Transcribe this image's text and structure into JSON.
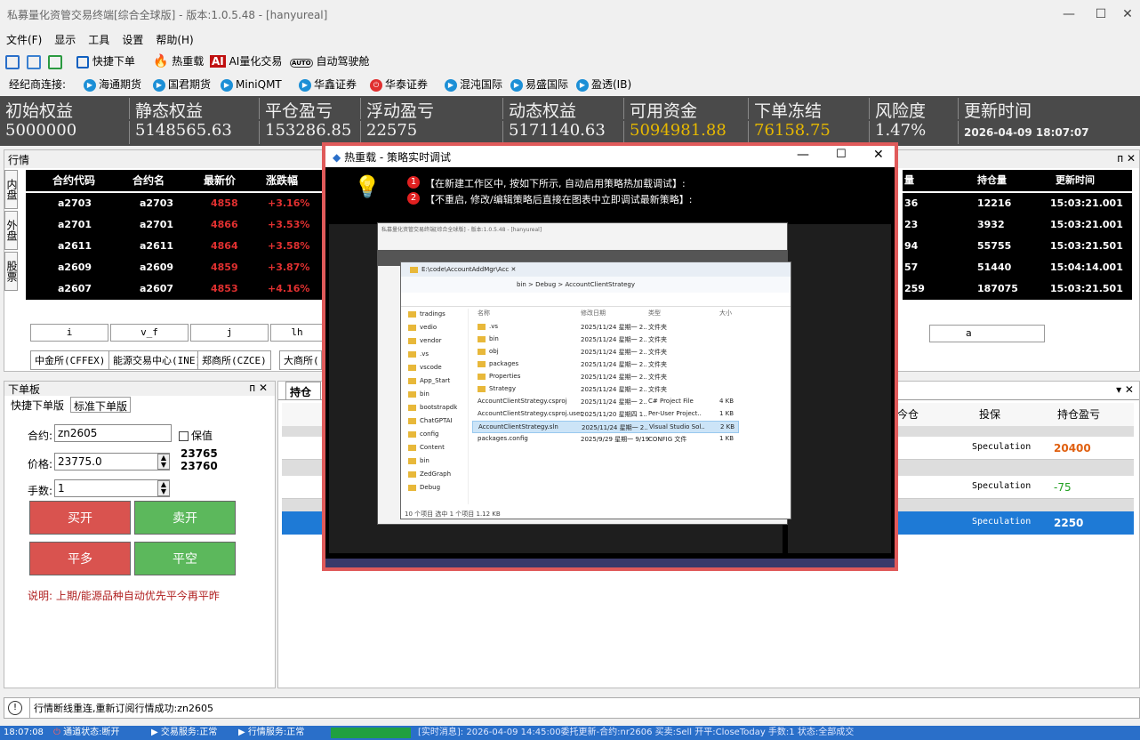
{
  "window": {
    "title": "私募量化资管交易终端[综合全球版] - 版本:1.0.5.48 - [hanyureal]",
    "min": "—",
    "max": "☐",
    "close": "✕"
  },
  "menu": [
    "文件(F)",
    "显示",
    "工具",
    "设置",
    "帮助(H)"
  ],
  "toolbar": {
    "quick_order": "快捷下单",
    "hot_load": "热重载",
    "ai_badge": "AI",
    "ai_quant": "AI量化交易",
    "auto_badge": "AUTO",
    "auto_drive": "自动驾驶舱"
  },
  "brokers": {
    "label": "经纪商连接:",
    "items": [
      "海通期货",
      "国君期货",
      "MiniQMT",
      "华鑫证券",
      "华泰证券",
      "混沌国际",
      "易盛国际",
      "盈透(IB)"
    ]
  },
  "account": {
    "headers": [
      "初始权益",
      "静态权益",
      "平仓盈亏",
      "浮动盈亏",
      "动态权益",
      "可用资金",
      "下单冻结",
      "风险度",
      "更新时间"
    ],
    "values": [
      "5000000",
      "5148565.63",
      "153286.85",
      "22575",
      "5171140.63",
      "5094981.88",
      "76158.75",
      "1.47%",
      "2026-04-09 18:07:07"
    ]
  },
  "market": {
    "panel_title": "行情",
    "pin": "ᴨ ✕",
    "side_tabs": [
      "内盘",
      "外盘",
      "股票"
    ],
    "headers": [
      "合约代码",
      "合约名",
      "最新价",
      "涨跌幅"
    ],
    "rows": [
      [
        "a2703",
        "a2703",
        "4858",
        "+3.16%"
      ],
      [
        "a2701",
        "a2701",
        "4866",
        "+3.53%"
      ],
      [
        "a2611",
        "a2611",
        "4864",
        "+3.58%"
      ],
      [
        "a2609",
        "a2609",
        "4859",
        "+3.87%"
      ],
      [
        "a2607",
        "a2607",
        "4853",
        "+4.16%"
      ]
    ],
    "right_headers": [
      "量",
      "持仓量",
      "更新时间"
    ],
    "right_rows": [
      [
        "36",
        "12216",
        "15:03:21.001"
      ],
      [
        "23",
        "3932",
        "15:03:21.001"
      ],
      [
        "94",
        "55755",
        "15:03:21.501"
      ],
      [
        "57",
        "51440",
        "15:04:14.001"
      ],
      [
        "259",
        "187075",
        "15:03:21.501"
      ]
    ],
    "col_buttons": [
      "i",
      "v_f",
      "j",
      "lh"
    ],
    "exchanges": [
      "中金所(CFFEX)",
      "能源交易中心(INE)",
      "郑商所(CZCE)",
      "大商所("
    ],
    "right_input": "a"
  },
  "order": {
    "panel_title": "下单板",
    "tabs": [
      "快捷下单版",
      "标准下单版"
    ],
    "contract_label": "合约:",
    "contract_value": "zn2605",
    "hedge_label": "保值",
    "price_label": "价格:",
    "price_value": "23775.0",
    "price_up": "23765",
    "price_down": "23760",
    "qty_label": "手数:",
    "qty_value": "1",
    "buy_open": "买开",
    "sell_open": "卖开",
    "close_long": "平多",
    "close_short": "平空",
    "note": "说明: 上期/能源品种自动优先平今再平昨"
  },
  "positions": {
    "tab": "持仓",
    "headers": [
      "今仓",
      "投保",
      "持仓盈亏"
    ],
    "rows": [
      {
        "hedge": "Speculation",
        "pnl": "20400",
        "color": "#e06010"
      },
      {
        "hedge": "Speculation",
        "pnl": "-75",
        "color": "#20a020"
      },
      {
        "hedge": "Speculation",
        "pnl": "2250",
        "color": "#ffffff"
      }
    ]
  },
  "statusline": {
    "text": "行情断线重连,重新订阅行情成功:zn2605"
  },
  "bottom": {
    "time": "18:07:08",
    "items": [
      "通道状态:断开",
      "交易服务:正常",
      "行情服务:正常"
    ],
    "message": "[实时消息]: 2026-04-09 14:45:00委托更新-合约:nr2606 买卖:Sell 开平:CloseToday 手数:1 状态:全部成交"
  },
  "popup": {
    "title": "热重载 - 策略实时调试",
    "step1": "【在新建工作区中, 按如下所示, 自动启用策略热加载调试】:",
    "step2": "【不重启, 修改/编辑策略后直接在图表中立即调试最新策略】:",
    "explorer_path": "E:\\code\\AccountAddMgr\\Acc",
    "breadcrumb": "bin  >  Debug  >  AccountClientStrategy",
    "folders": [
      "tradings",
      "vedio",
      "vendor",
      ".vs",
      "vscode",
      "App_Start",
      "bin",
      "bootstrapdk",
      "ChatGPTAI",
      "config",
      "Content",
      "bin",
      "ZedGraph",
      "Debug"
    ],
    "files": [
      {
        "name": ".vs",
        "date": "2025/11/24 星期一 2..",
        "type": "文件夹",
        "size": ""
      },
      {
        "name": "bin",
        "date": "2025/11/24 星期一 2..",
        "type": "文件夹",
        "size": ""
      },
      {
        "name": "obj",
        "date": "2025/11/24 星期一 2..",
        "type": "文件夹",
        "size": ""
      },
      {
        "name": "packages",
        "date": "2025/11/24 星期一 2..",
        "type": "文件夹",
        "size": ""
      },
      {
        "name": "Properties",
        "date": "2025/11/24 星期一 2..",
        "type": "文件夹",
        "size": ""
      },
      {
        "name": "Strategy",
        "date": "2025/11/24 星期一 2..",
        "type": "文件夹",
        "size": ""
      },
      {
        "name": "AccountClientStrategy.csproj",
        "date": "2025/11/24 星期一 2..",
        "type": "C# Project File",
        "size": "4 KB"
      },
      {
        "name": "AccountClientStrategy.csproj.user",
        "date": "2025/11/20 星期四 1..",
        "type": "Per-User Project..",
        "size": "1 KB"
      },
      {
        "name": "AccountClientStrategy.sln",
        "date": "2025/11/24 星期一 2..",
        "type": "Visual Studio Sol..",
        "size": "2 KB"
      },
      {
        "name": "packages.config",
        "date": "2025/9/29 星期一 9/19",
        "type": "CONFIG 文件",
        "size": "1 KB"
      }
    ],
    "file_headers": [
      "名称",
      "修改日期",
      "类型",
      "大小"
    ],
    "footer": "10 个项目  选中 1 个项目  1.12 KB",
    "min": "—",
    "max": "☐",
    "close": "✕"
  }
}
